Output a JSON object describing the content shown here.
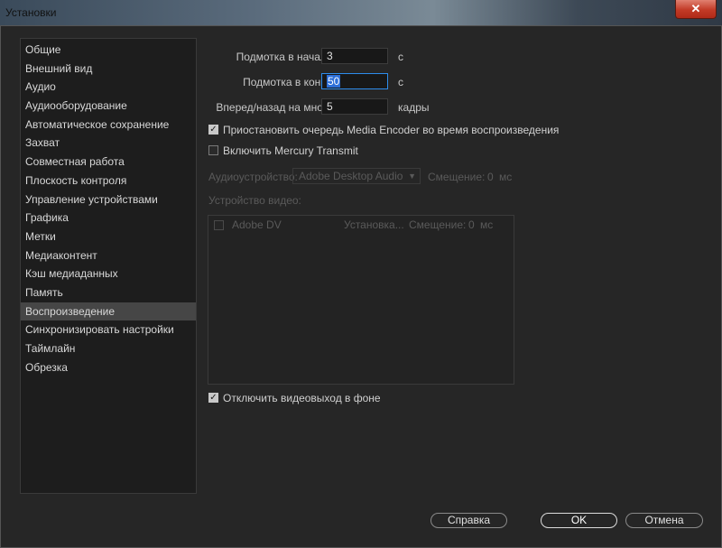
{
  "window": {
    "title": "Установки",
    "close_glyph": "✕"
  },
  "sidebar": {
    "items": [
      {
        "label": "Общие"
      },
      {
        "label": "Внешний вид"
      },
      {
        "label": "Аудио"
      },
      {
        "label": "Аудиооборудование"
      },
      {
        "label": "Автоматическое сохранение"
      },
      {
        "label": "Захват"
      },
      {
        "label": "Совместная работа"
      },
      {
        "label": "Плоскость контроля"
      },
      {
        "label": "Управление устройствами"
      },
      {
        "label": "Графика"
      },
      {
        "label": "Метки"
      },
      {
        "label": "Медиаконтент"
      },
      {
        "label": "Кэш медиаданных"
      },
      {
        "label": "Память"
      },
      {
        "label": "Воспроизведение",
        "selected": true
      },
      {
        "label": "Синхронизировать настройки"
      },
      {
        "label": "Таймлайн"
      },
      {
        "label": "Обрезка"
      }
    ]
  },
  "playback": {
    "preroll": {
      "label": "Подмотка в начале:",
      "value": "3",
      "unit": "с"
    },
    "postroll": {
      "label": "Подмотка в конце:",
      "value": "50",
      "unit": "с"
    },
    "step": {
      "label": "Вперед/назад на много:",
      "value": "5",
      "unit": "кадры"
    },
    "pause_media_encoder": {
      "label": "Приостановить очередь Media Encoder во время воспроизведения",
      "checked": true
    },
    "mercury_transmit": {
      "label": "Включить Mercury Transmit",
      "checked": false
    },
    "audio_device": {
      "label": "Аудиоустройство:",
      "value": "Adobe Desktop Audio",
      "offset_label": "Смещение:",
      "offset_value": "0",
      "offset_unit": "мс"
    },
    "video_device_label": "Устройство видео:",
    "video_devices": [
      {
        "name": "Adobe DV",
        "setup": "Установка...",
        "offset_label": "Смещение:",
        "offset_value": "0",
        "offset_unit": "мс",
        "checked": false
      }
    ],
    "disable_video_bg": {
      "label": "Отключить видеовыход в фоне",
      "checked": true
    }
  },
  "buttons": {
    "help": "Справка",
    "ok": "OK",
    "cancel": "Отмена"
  }
}
